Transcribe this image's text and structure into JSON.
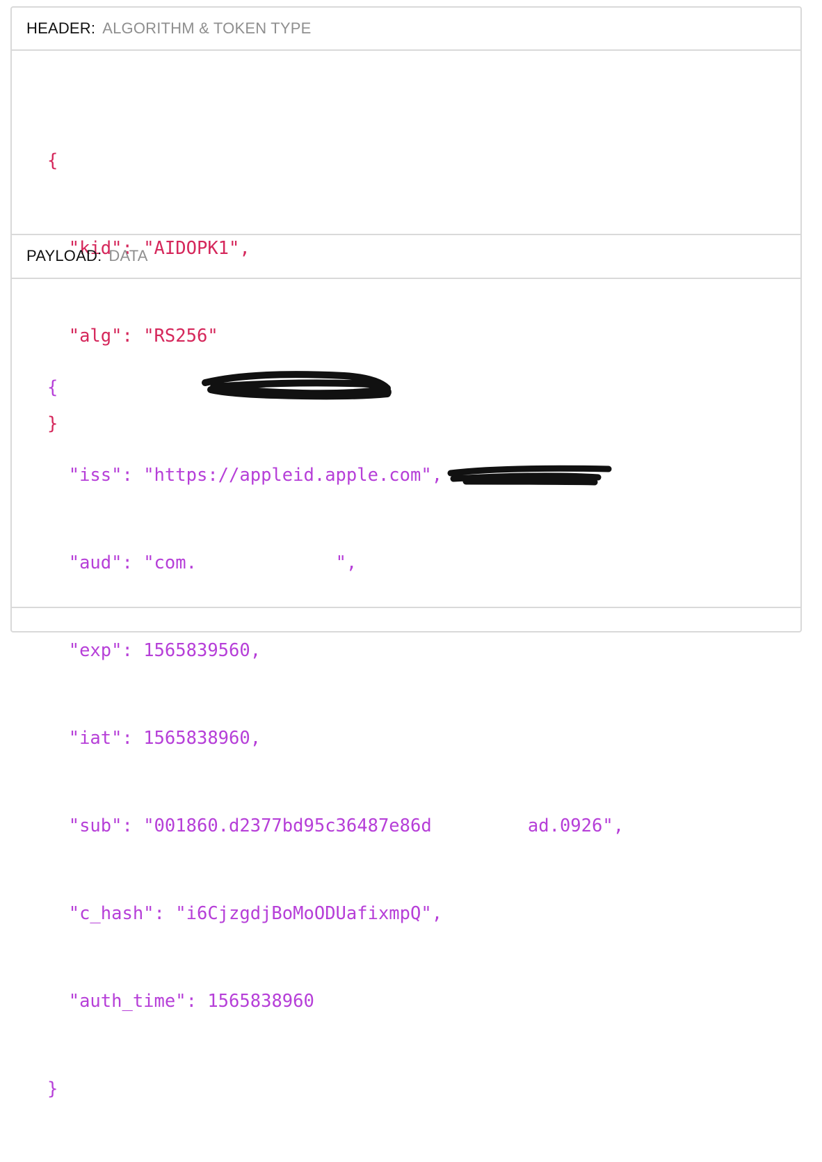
{
  "header": {
    "title": "HEADER:",
    "subtitle": "ALGORITHM & TOKEN TYPE",
    "code": {
      "open": "{",
      "kid_key": "\"kid\"",
      "kid_value": "\"AIDOPK1\"",
      "alg_key": "\"alg\"",
      "alg_value": "\"RS256\"",
      "close": "}"
    },
    "color": "#d5275b"
  },
  "payload": {
    "title": "PAYLOAD:",
    "subtitle": "DATA",
    "code": {
      "open": "{",
      "iss_key": "\"iss\"",
      "iss_value": "\"https://appleid.apple.com\"",
      "aud_key": "\"aud\"",
      "aud_value": "\"com.",
      "aud_tail": "\"",
      "exp_key": "\"exp\"",
      "exp_value": "1565839560",
      "iat_key": "\"iat\"",
      "iat_value": "1565838960",
      "sub_key": "\"sub\"",
      "sub_value": "\"001860.d2377bd95c36487e86d",
      "sub_tail": "ad.0926\"",
      "c_hash_key": "\"c_hash\"",
      "c_hash_value": "\"i6CjzgdjBoMoODUafixmpQ\"",
      "auth_time_key": "\"auth_time\"",
      "auth_time_value": "1565838960",
      "close": "}"
    },
    "color": "#b63fd8"
  }
}
